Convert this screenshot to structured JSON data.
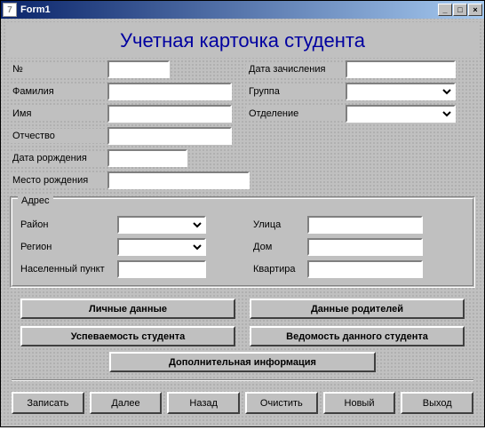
{
  "window": {
    "title": "Form1"
  },
  "heading": "Учетная карточка студента",
  "left_fields": {
    "number": {
      "label": "№",
      "value": ""
    },
    "surname": {
      "label": "Фамилия",
      "value": ""
    },
    "name": {
      "label": "Имя",
      "value": ""
    },
    "patronymic": {
      "label": "Отчество",
      "value": ""
    }
  },
  "right_fields": {
    "enroll_date": {
      "label": "Дата зачисления",
      "value": ""
    },
    "group": {
      "label": "Группа",
      "value": ""
    },
    "department": {
      "label": "Отделение",
      "value": ""
    }
  },
  "extra": {
    "birth_date": {
      "label": "Дата рорждения",
      "value": ""
    },
    "birth_place": {
      "label": "Место рождения",
      "value": ""
    }
  },
  "address": {
    "caption": "Адрес",
    "district": {
      "label": "Район",
      "value": ""
    },
    "region": {
      "label": "Регион",
      "value": ""
    },
    "locality": {
      "label": "Населенный пункт",
      "value": ""
    },
    "street": {
      "label": "Улица",
      "value": ""
    },
    "house": {
      "label": "Дом",
      "value": ""
    },
    "flat": {
      "label": "Квартира",
      "value": ""
    }
  },
  "big_buttons": {
    "personal": "Личные данные",
    "parents": "Данные родителей",
    "progress": "Успеваемость студента",
    "vedomost": "Ведомость данного студента",
    "additional": "Дополнительная информация"
  },
  "bottom": {
    "save": "Записать",
    "next": "Далее",
    "back": "Назад",
    "clear": "Очистить",
    "new": "Новый",
    "exit": "Выход"
  }
}
